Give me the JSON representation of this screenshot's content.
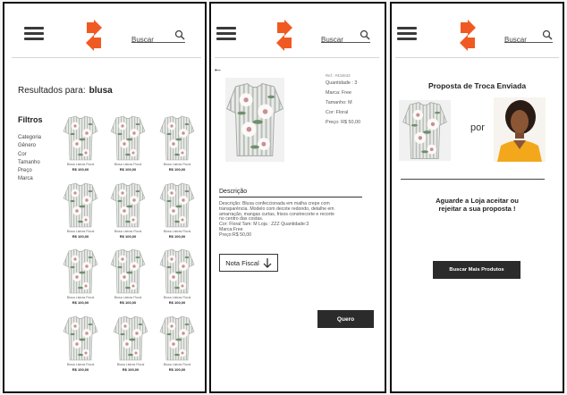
{
  "header": {
    "search_placeholder": "Buscar",
    "menu_icon": "hamburger-menu-icon",
    "search_icon": "magnifier-icon",
    "logo_icon": "orange-exchange-arrows-logo"
  },
  "colors": {
    "brand_orange": "#f05a22",
    "button_dark": "#2b2b2b",
    "frame_border": "#111111"
  },
  "results_screen": {
    "results_label": "Resultados para:",
    "query": "blusa",
    "filters_title": "Filtros",
    "filters": [
      "Categoria",
      "Gênero",
      "Cor",
      "Tamanho",
      "Preço",
      "Marca"
    ],
    "products": [
      {
        "name": "Blusa Listras Floral",
        "price": "R$ 100,00"
      },
      {
        "name": "Blusa Listras Floral",
        "price": "R$ 100,00"
      },
      {
        "name": "Blusa Listras Floral",
        "price": "R$ 100,00"
      },
      {
        "name": "Blusa Listras Floral",
        "price": "R$ 100,00"
      },
      {
        "name": "Blusa Listras Floral",
        "price": "R$ 100,00"
      },
      {
        "name": "Blusa Listras Floral",
        "price": "R$ 100,00"
      },
      {
        "name": "Blusa Listras Floral",
        "price": "R$ 100,00"
      },
      {
        "name": "Blusa Listras Floral",
        "price": "R$ 100,00"
      },
      {
        "name": "Blusa Listras Floral",
        "price": "R$ 100,00"
      },
      {
        "name": "Blusa Listras Floral",
        "price": "R$ 100,00"
      },
      {
        "name": "Blusa Listras Floral",
        "price": "R$ 100,00"
      },
      {
        "name": "Blusa Listras Floral",
        "price": "R$ 100,00"
      }
    ]
  },
  "detail_screen": {
    "back_icon": "back-arrow-icon",
    "ref": "Ref.: #434643",
    "quantity": "Quantidade : 3",
    "brand": "Marca: Free",
    "size": "Tamanho: M",
    "color": "Cor: Floral",
    "price": "Preço: R$ 50,00",
    "description_title": "Descrição",
    "description_lines": [
      "Descrição: Blusa confeccionada em malha crepe com",
      "transparência. Modelo com decote redondo, detalhe em",
      "amarração, mangas curtas, frisos constrecorte e recorte",
      "no centro das costas.",
      "Cor: Floral Tam: M Loja : ZZZ Quantidade:3",
      "Marca:Free",
      "Preço:R$ 50,00"
    ],
    "invoice_button": "Nota Fiscal",
    "invoice_icon": "download-arrow-icon",
    "want_button": "Quero"
  },
  "confirm_screen": {
    "title": "Proposta de Troca Enviada",
    "por": "por",
    "message_lines": [
      "Aguarde a Loja aceitar ou",
      "rejeitar a sua proposta !"
    ],
    "more_button": "Buscar Mais Produtos"
  }
}
